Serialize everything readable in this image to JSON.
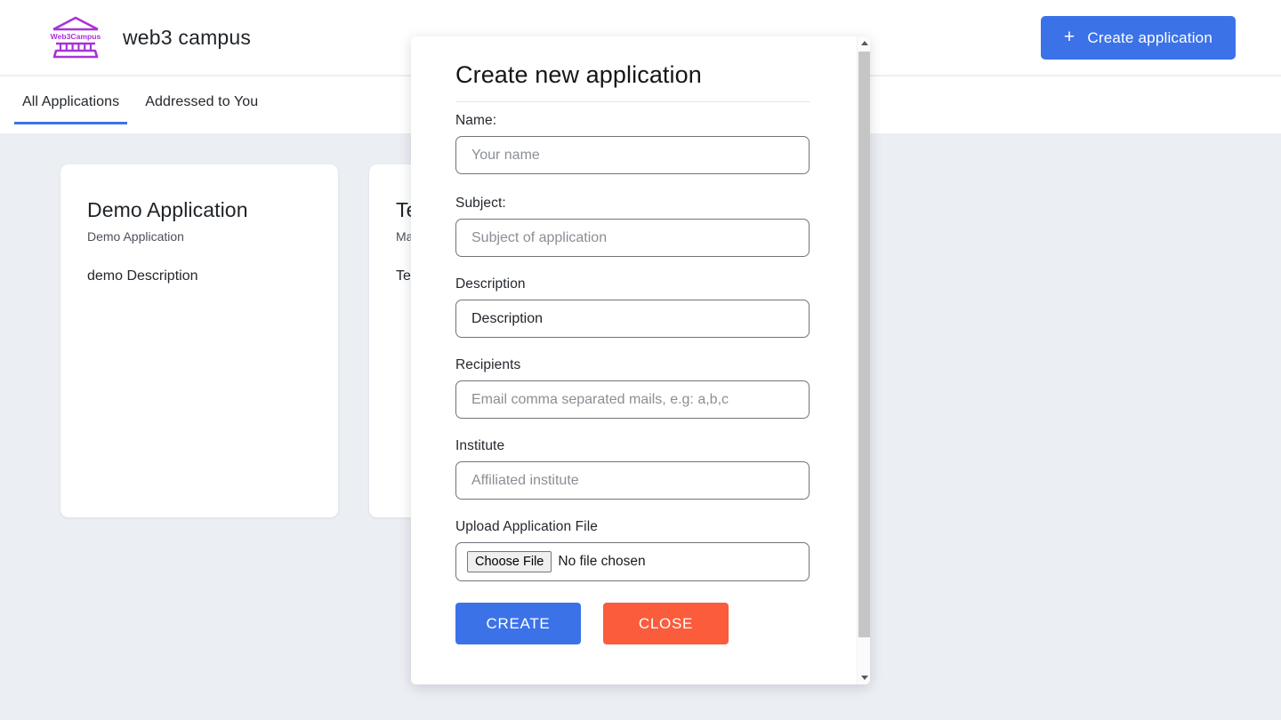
{
  "header": {
    "logo_alt": "Web3Campus",
    "logo_text": "Web3Campus",
    "brand_title": "web3 campus",
    "create_button_label": "Create application",
    "create_button_icon": "plus-icon",
    "accent_color": "#3b72e8",
    "logo_color": "#a733d8"
  },
  "tabs": [
    {
      "label": "All Applications",
      "active": true
    },
    {
      "label": "Addressed to You",
      "active": false
    }
  ],
  "cards": [
    {
      "title": "Demo Application",
      "subtitle": "Demo Application",
      "description": "demo Description"
    },
    {
      "title": "Te",
      "subtitle": "Ma",
      "description": "Te"
    }
  ],
  "modal": {
    "title": "Create new application",
    "fields": [
      {
        "label": "Name:",
        "placeholder": "Your name",
        "value": ""
      },
      {
        "label": "Subject:",
        "placeholder": "Subject of application",
        "value": ""
      },
      {
        "label": "Description",
        "placeholder": "",
        "value": "Description"
      },
      {
        "label": "Recipients",
        "placeholder": "Email comma separated mails, e.g: a,b,c",
        "value": ""
      },
      {
        "label": "Institute",
        "placeholder": "Affiliated institute",
        "value": ""
      }
    ],
    "upload": {
      "label": "Upload Application File",
      "button_label": "Choose File",
      "status_text": "No file chosen"
    },
    "buttons": {
      "create_label": "CREATE",
      "create_color": "#3b72e8",
      "close_label": "CLOSE",
      "close_color": "#fa5c3c"
    },
    "scrollbar": {
      "up_icon": "caret-up-icon",
      "down_icon": "caret-down-icon"
    }
  },
  "page": {
    "background_color": "#ebeef3"
  }
}
